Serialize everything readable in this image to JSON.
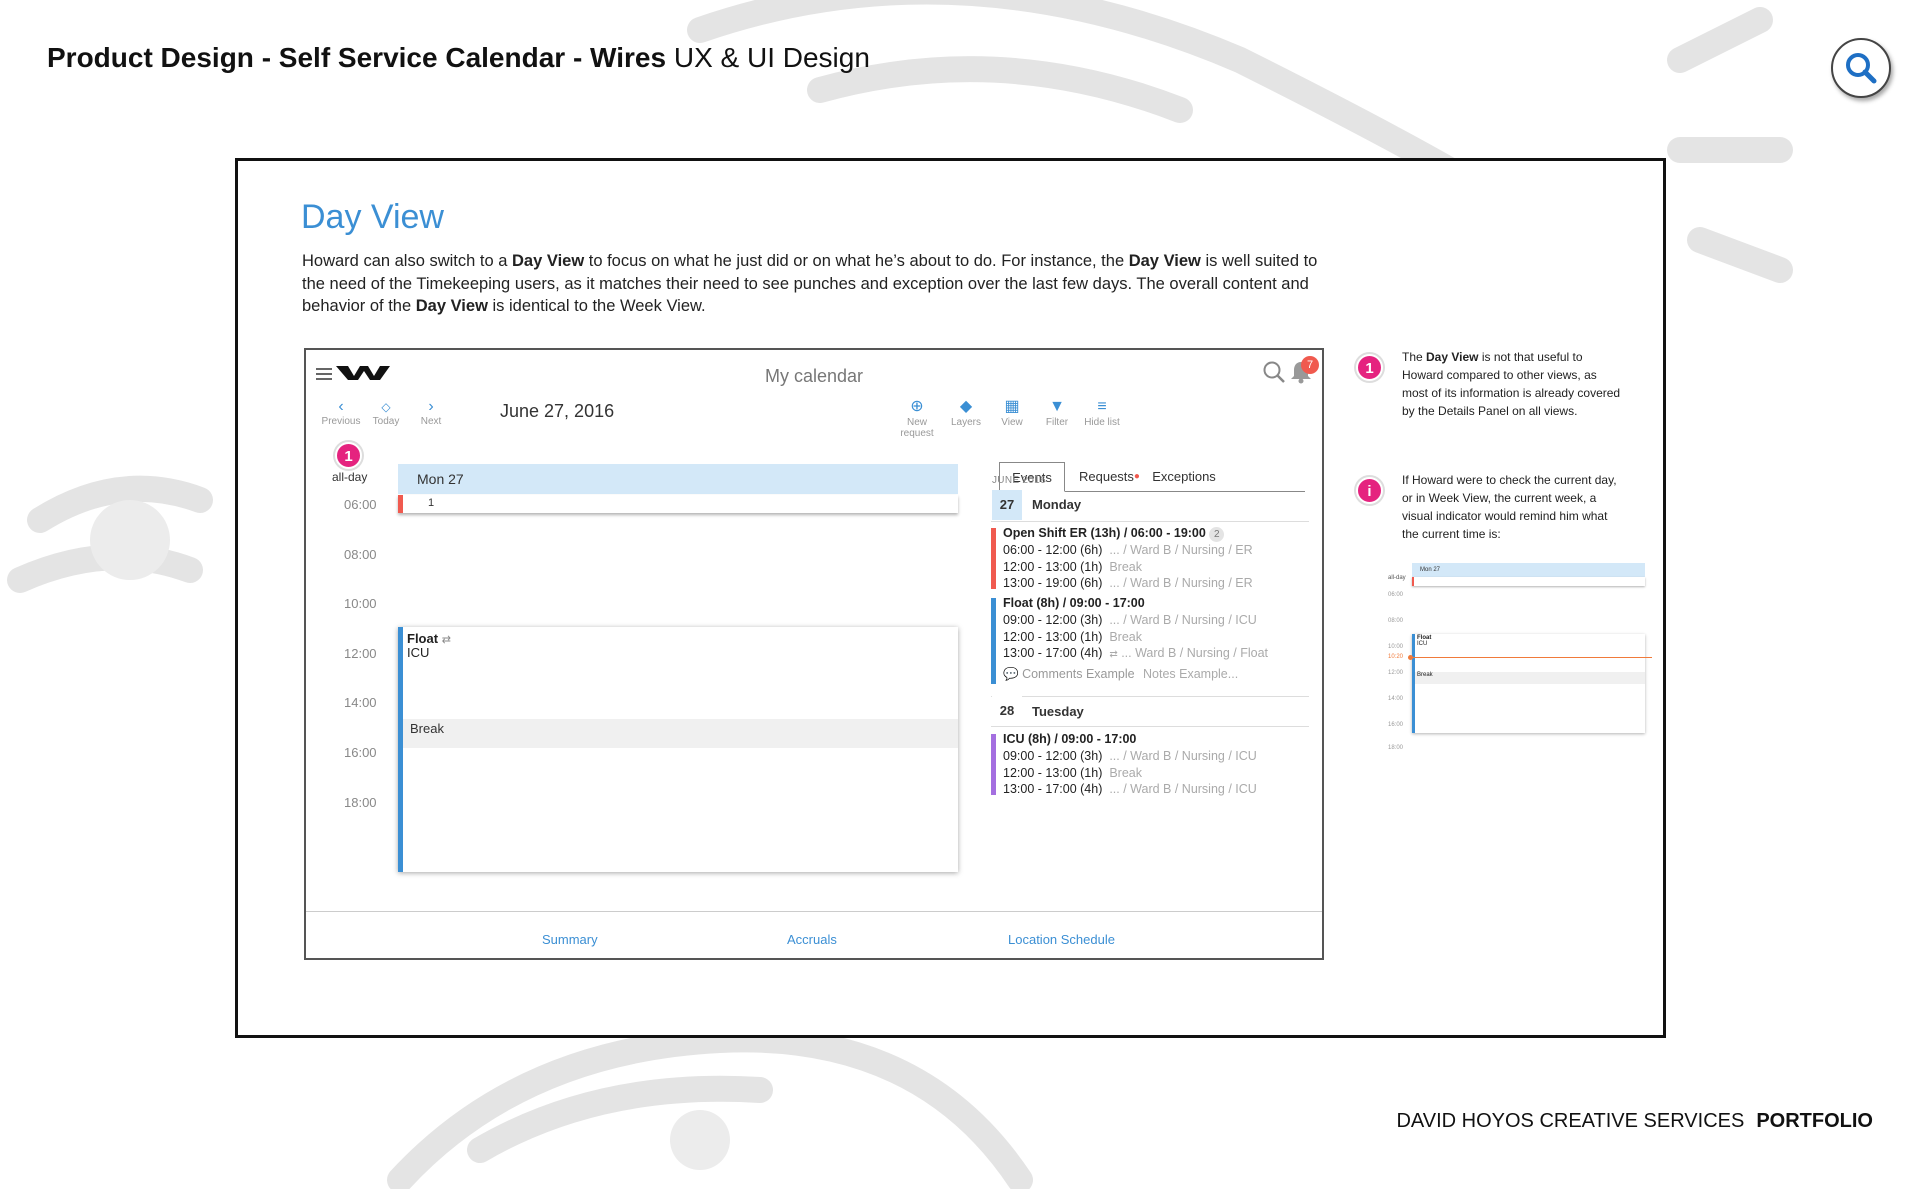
{
  "header": {
    "bold": "Product Design - Self Service Calendar - Wires",
    "light": "UX & UI Design"
  },
  "footer": {
    "company": "DAVID HOYOS CREATIVE SERVICES",
    "portfolio": "PORTFOLIO"
  },
  "icons": {
    "search": "search-icon"
  },
  "slide": {
    "title": "Day View",
    "intro": {
      "p1": "Howard can also switch to a ",
      "b1": "Day View",
      "p2": " to focus on what he just did or on what he’s about to do. For instance, the ",
      "b2": "Day View",
      "p3": " is well suited to the need of the Timekeeping users, as it matches their need to see punches and exception over the last few days. The overall content and behavior of the ",
      "b3": "Day View",
      "p4": " is identical to the Week View."
    }
  },
  "app": {
    "title": "My calendar",
    "notif_count": "7",
    "nav": {
      "previous": "Previous",
      "today": "Today",
      "next": "Next"
    },
    "date": "June 27, 2016",
    "toolbar": {
      "new": "New",
      "request": "request",
      "layers": "Layers",
      "view": "View",
      "filter": "Filter",
      "hide": "Hide list"
    },
    "badge": "1",
    "allday_label": "all-day",
    "day_header": "Mon 27",
    "allday_count": "1",
    "times": [
      "06:00",
      "08:00",
      "10:00",
      "12:00",
      "14:00",
      "16:00",
      "18:00"
    ],
    "event": {
      "title": "Float",
      "sub": "ICU",
      "break": "Break"
    },
    "tabs": {
      "events": "Events",
      "requests": "Requests",
      "exceptions": "Exceptions"
    },
    "month": "JUNE 2016",
    "day1": {
      "num": "27",
      "name": "Monday"
    },
    "s1": {
      "title": "Open Shift ER (13h) / 06:00 - 19:00",
      "count": "2",
      "r1t": "06:00 - 12:00 (6h)",
      "r1d": "... / Ward B / Nursing / ER",
      "r2t": "12:00 - 13:00 (1h)",
      "r2d": "Break",
      "r3t": "13:00 - 19:00 (6h)",
      "r3d": "... / Ward B / Nursing / ER"
    },
    "s2": {
      "title": "Float (8h) / 09:00 - 17:00",
      "r1t": "09:00 - 12:00 (3h)",
      "r1d": "... / Ward B / Nursing / ICU",
      "r2t": "12:00 - 13:00 (1h)",
      "r2d": "Break",
      "r3t": "13:00 - 17:00 (4h)",
      "r3d": "... Ward B / Nursing / Float",
      "comments": "Comments Example",
      "notes": "Notes Example..."
    },
    "day2": {
      "num": "28",
      "name": "Tuesday"
    },
    "s3": {
      "title": "ICU (8h) / 09:00 - 17:00",
      "r1t": "09:00 - 12:00 (3h)",
      "r1d": "... / Ward B / Nursing / ICU",
      "r2t": "12:00 - 13:00 (1h)",
      "r2d": "Break",
      "r3t": "13:00 - 17:00 (4h)",
      "r3d": "... / Ward B / Nursing / ICU"
    },
    "bottom": {
      "summary": "Summary",
      "accruals": "Accruals",
      "location": "Location Schedule"
    }
  },
  "notes": {
    "n1": {
      "badge": "1",
      "a": "The ",
      "b": "Day View",
      "c": " is not that useful to Howard compared to other views, as most of its information is already covered by the Details Panel on all views."
    },
    "n2": {
      "badge": "i",
      "text": "If Howard were to check the current day, or in Week View, the current week, a visual indicator would remind him what the current time is:"
    }
  },
  "mini": {
    "day_header": "Mon 27",
    "allday": "all-day",
    "times": [
      "06:00",
      "08:00",
      "10:00",
      "12:00",
      "14:00",
      "16:00",
      "18:00"
    ],
    "now": "10:20",
    "event": "Float",
    "sub": "ICU",
    "break": "Break"
  },
  "colors": {
    "accent": "#3b8fd4",
    "pink": "#e5237f",
    "red": "#f05a4f",
    "purple": "#a46fe0",
    "orange": "#f07a3a"
  }
}
